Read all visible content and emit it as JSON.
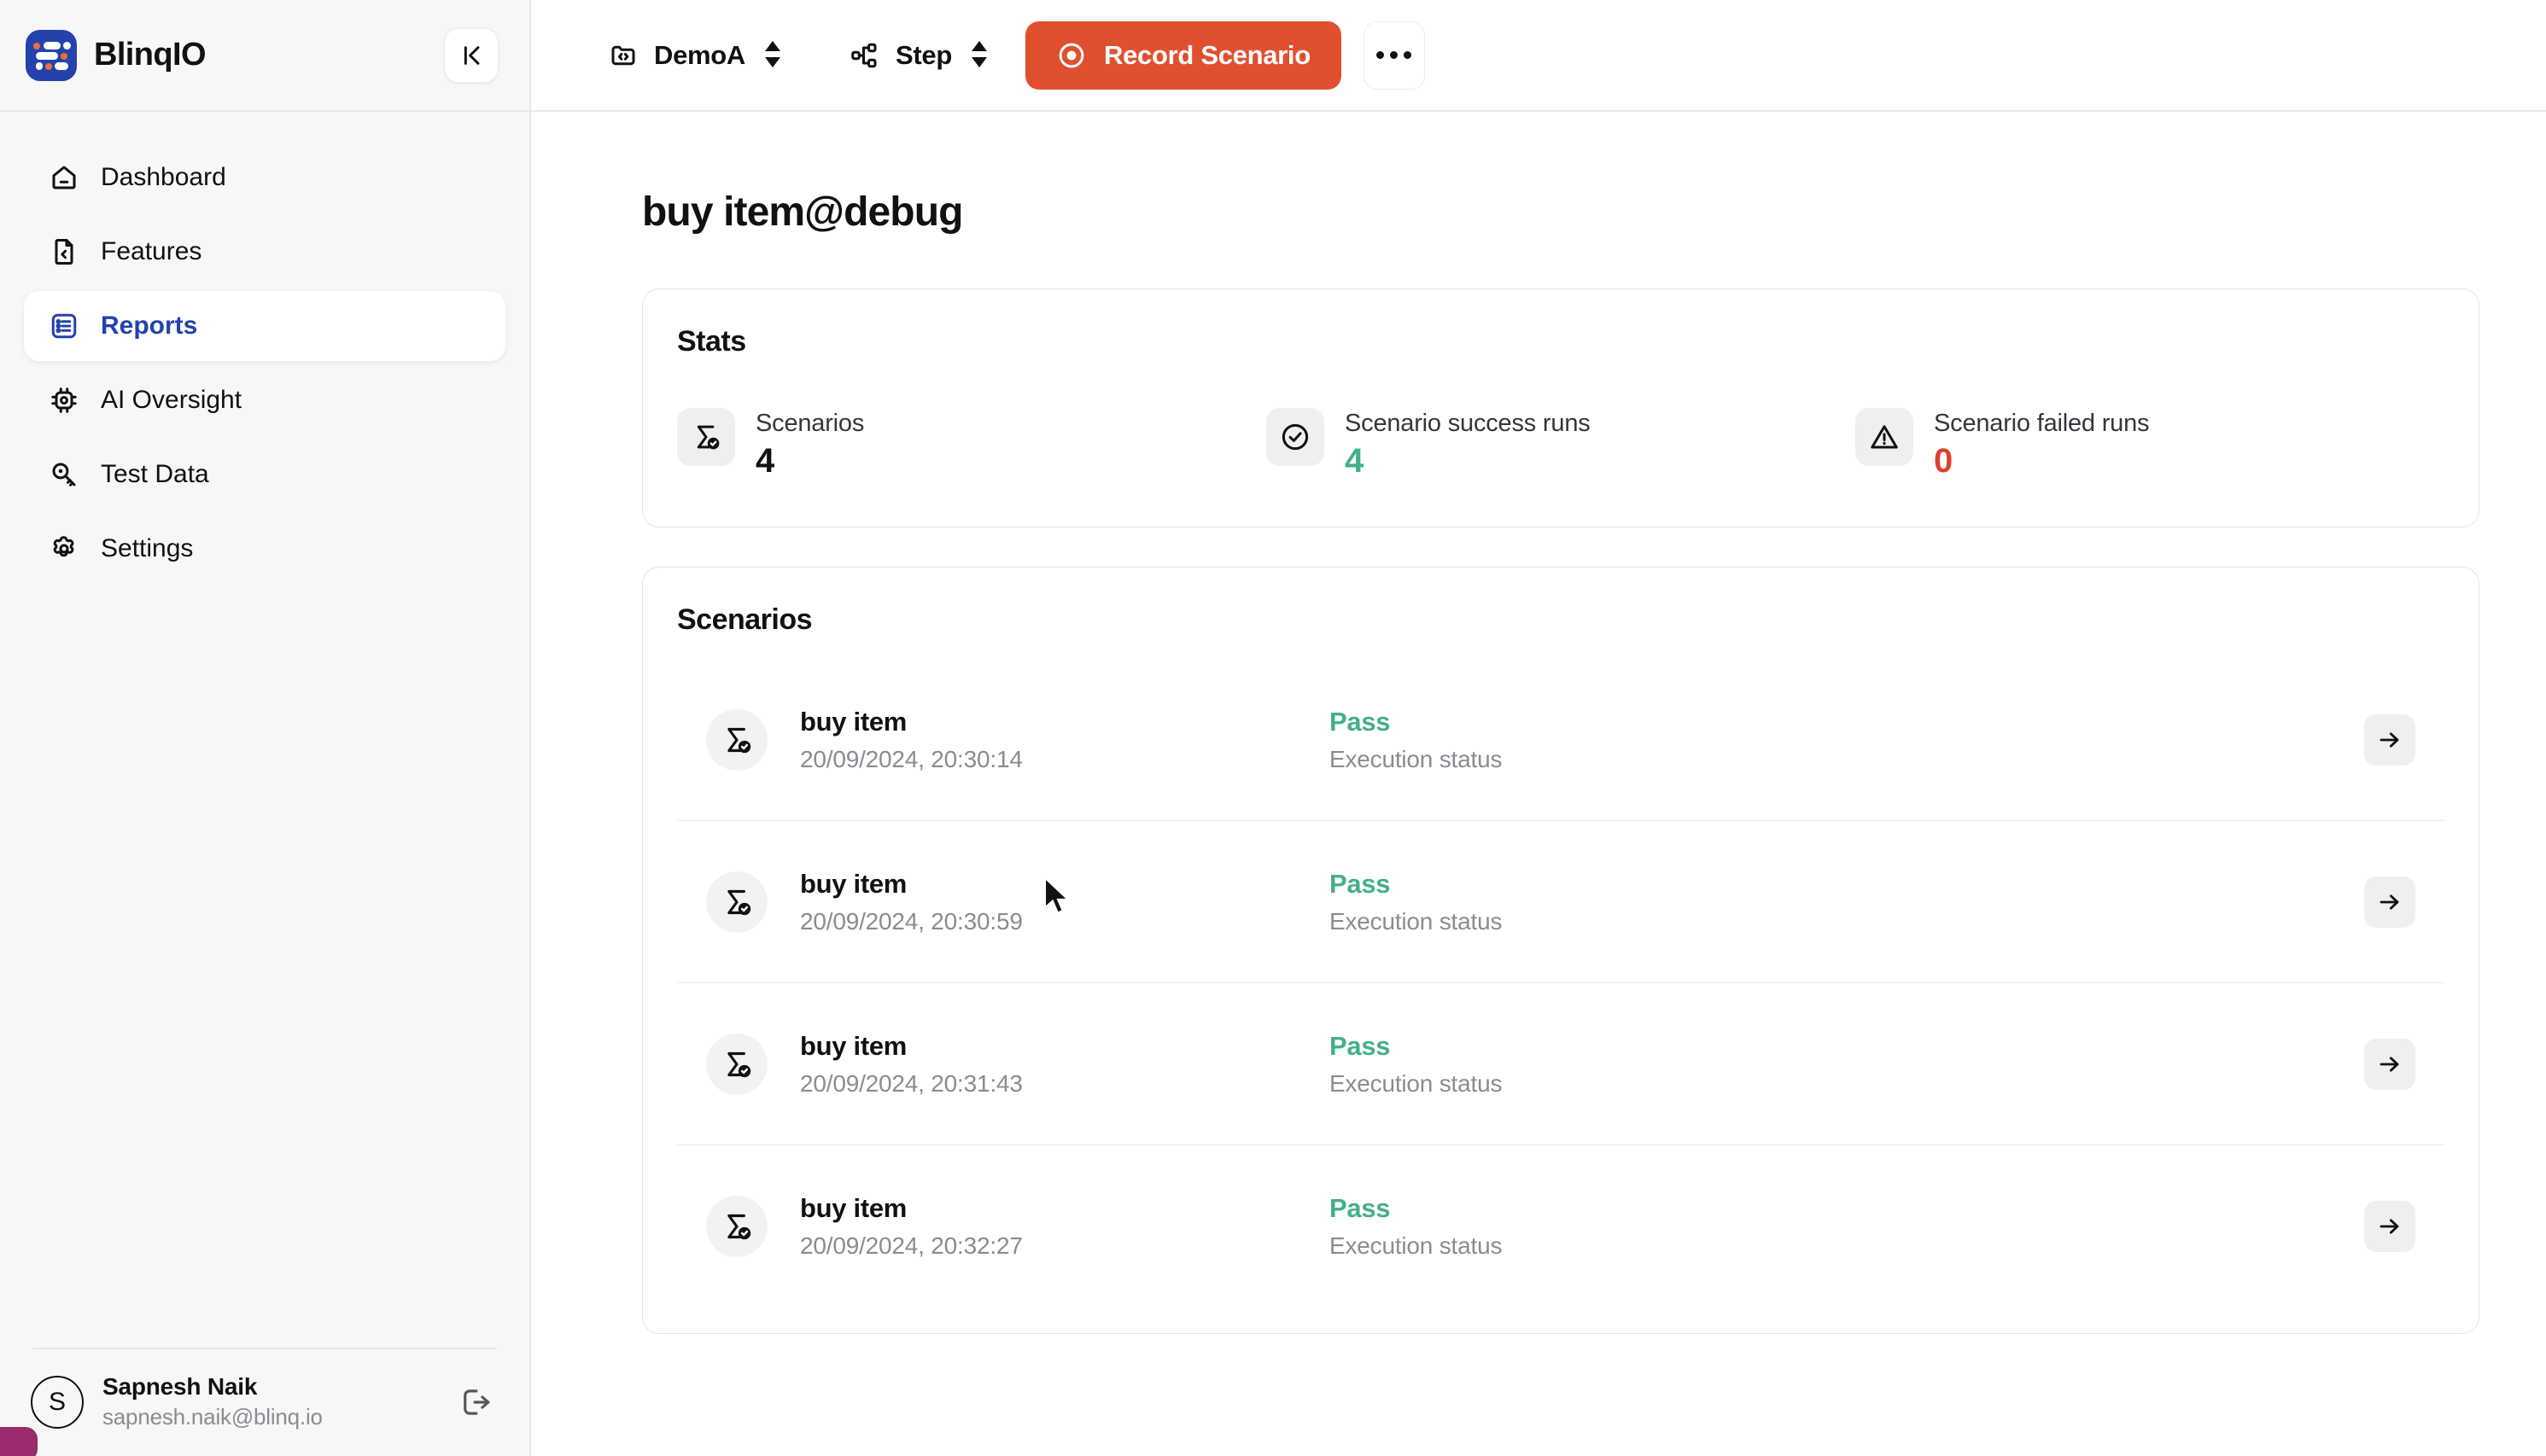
{
  "brand": {
    "name": "BlinqIO",
    "logo_icon": "blinqio-logo",
    "collapse_icon": "collapse-sidebar-icon"
  },
  "sidebar": {
    "items": [
      {
        "label": "Dashboard",
        "icon": "home-icon",
        "active": false
      },
      {
        "label": "Features",
        "icon": "file-code-icon",
        "active": false
      },
      {
        "label": "Reports",
        "icon": "list-report-icon",
        "active": true
      },
      {
        "label": "AI Oversight",
        "icon": "cpu-chip-icon",
        "active": false
      },
      {
        "label": "Test Data",
        "icon": "key-search-icon",
        "active": false
      },
      {
        "label": "Settings",
        "icon": "gear-icon",
        "active": false
      }
    ],
    "user": {
      "initial": "S",
      "name": "Sapnesh Naik",
      "email": "sapnesh.naik@blinq.io",
      "logout_icon": "logout-icon"
    }
  },
  "toolbar": {
    "project_label": "DemoA",
    "project_icon": "code-folder-icon",
    "step_label": "Step",
    "step_icon": "workflow-icon",
    "record_label": "Record Scenario",
    "record_icon": "record-circle-icon",
    "record_color": "#e0502f",
    "more_icon": "more-horizontal-icon",
    "selector_icon": "up-down-chevrons-icon"
  },
  "page": {
    "title": "buy item@debug"
  },
  "stats": {
    "title": "Stats",
    "items": [
      {
        "label": "Scenarios",
        "value": "4",
        "icon": "sigma-check-icon",
        "tone": "neutral"
      },
      {
        "label": "Scenario success runs",
        "value": "4",
        "icon": "check-circle-icon",
        "tone": "ok"
      },
      {
        "label": "Scenario failed runs",
        "value": "0",
        "icon": "warning-triangle-icon",
        "tone": "bad"
      }
    ]
  },
  "scenarios": {
    "title": "Scenarios",
    "status_sublabel": "Execution status",
    "row_icon": "sigma-check-icon",
    "go_icon": "arrow-right-icon",
    "rows": [
      {
        "name": "buy item",
        "timestamp": "20/09/2024, 20:30:14",
        "status": "Pass"
      },
      {
        "name": "buy item",
        "timestamp": "20/09/2024, 20:30:59",
        "status": "Pass"
      },
      {
        "name": "buy item",
        "timestamp": "20/09/2024, 20:31:43",
        "status": "Pass"
      },
      {
        "name": "buy item",
        "timestamp": "20/09/2024, 20:32:27",
        "status": "Pass"
      }
    ]
  },
  "colors": {
    "accent": "#2442ab",
    "record": "#e0502f",
    "pass": "#44b08a",
    "fail": "#e0402f"
  }
}
